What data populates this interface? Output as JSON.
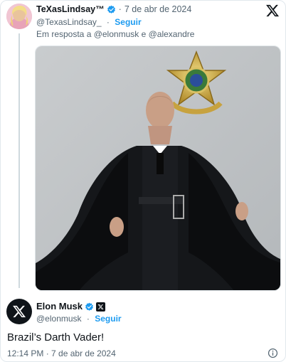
{
  "parent": {
    "display_name": "TeXasLindsay™",
    "timestamp": "7 de abr de 2024",
    "handle": "@TexasLindsay_",
    "follow_label": "Seguir",
    "reply_to": "Em resposta a @elonmusk e @alexandre",
    "separator": "·"
  },
  "reply": {
    "display_name": "Elon Musk",
    "handle": "@elonmusk",
    "follow_label": "Seguir",
    "separator": "·",
    "text": "Brazil’s Darth Vader!",
    "timestamp": "12:14 PM · 7 de abr de 2024"
  },
  "icons": {
    "brand": "x-logo-icon",
    "verified": "verified-badge-icon",
    "affiliate": "x-affiliate-badge-icon",
    "info": "info-icon"
  },
  "colors": {
    "accent": "#1d9bf0",
    "text": "#0f1419",
    "muted": "#536471",
    "thread_line": "#cfd9de"
  }
}
